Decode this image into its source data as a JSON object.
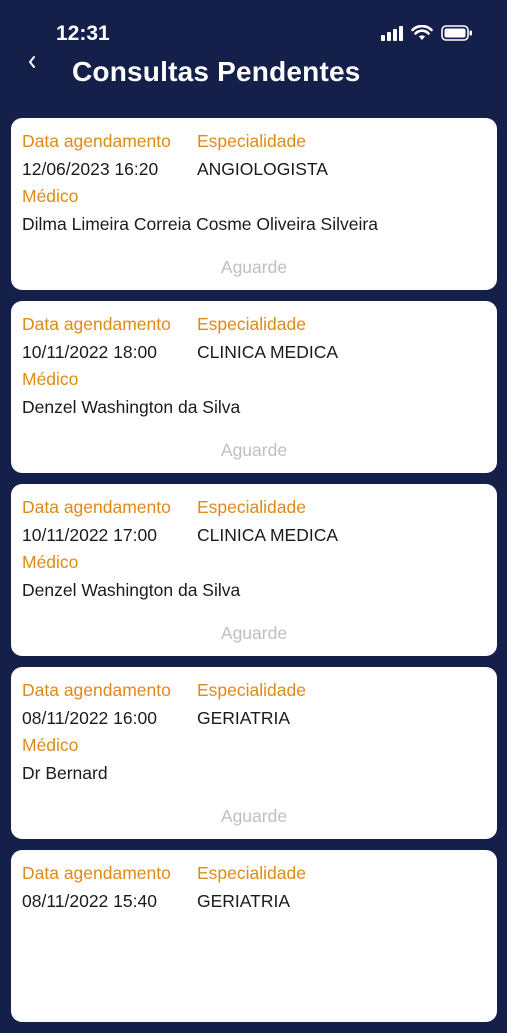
{
  "status_bar": {
    "time": "12:31",
    "icons": [
      "signal-icon",
      "wifi-icon",
      "battery-icon"
    ]
  },
  "header": {
    "back_icon": "chevron-left-icon",
    "title": "Consultas Pendentes"
  },
  "labels": {
    "date": "Data agendamento",
    "specialty": "Especialidade",
    "doctor": "Médico"
  },
  "appointments": [
    {
      "date": "12/06/2023 16:20",
      "specialty": "ANGIOLOGISTA",
      "doctor": "Dilma Limeira Correia Cosme Oliveira Silveira",
      "status": "Aguarde"
    },
    {
      "date": "10/11/2022 18:00",
      "specialty": "CLINICA MEDICA",
      "doctor": "Denzel Washington da Silva",
      "status": "Aguarde"
    },
    {
      "date": "10/11/2022 17:00",
      "specialty": "CLINICA MEDICA",
      "doctor": "Denzel Washington da Silva",
      "status": "Aguarde"
    },
    {
      "date": "08/11/2022 16:00",
      "specialty": "GERIATRIA",
      "doctor": "Dr Bernard",
      "status": "Aguarde"
    },
    {
      "date": "08/11/2022 15:40",
      "specialty": "GERIATRIA",
      "doctor": "",
      "status": ""
    }
  ],
  "colors": {
    "background": "#14204a",
    "label": "#e08a16",
    "status": "#bfbfbf"
  }
}
